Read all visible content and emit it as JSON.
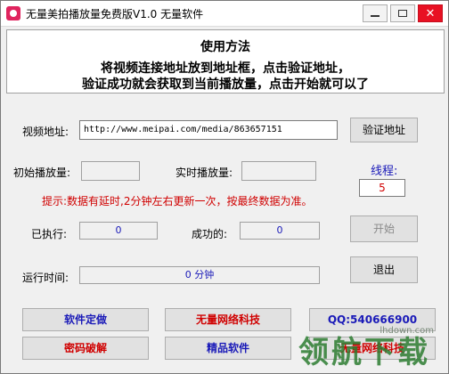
{
  "window": {
    "title": "无量美拍播放量免费版V1.0     无量软件"
  },
  "banner": {
    "title": "使用方法",
    "line1": "将视频连接地址放到地址框，点击验证地址，",
    "line2": "验证成功就会获取到当前播放量，点击开始就可以了"
  },
  "form": {
    "video_url_label": "视频地址:",
    "video_url_value": "http://www.meipai.com/media/863657151",
    "verify_button": "验证地址",
    "initial_plays_label": "初始播放量:",
    "realtime_plays_label": "实时播放量:",
    "thread_label": "线程:",
    "thread_value": "5",
    "hint": "提示:数据有延时,2分钟左右更新一次，按最终数据为准。",
    "executed_label": "已执行:",
    "executed_value": "0",
    "success_label": "成功的:",
    "success_value": "0",
    "start_button": "开始",
    "runtime_label": "运行时间:",
    "runtime_value": "0 分钟",
    "exit_button": "退出"
  },
  "footer": {
    "btn_software_custom": "软件定做",
    "btn_wuliang_tech": "无量网络科技",
    "btn_qq": "QQ:540666900",
    "btn_crack": "密码破解",
    "btn_quality_software": "精品软件",
    "btn_wuliang_tech_2": "无量网络科技"
  },
  "watermark": {
    "text": "领航下载",
    "url": "lhdown.com"
  },
  "colors": {
    "close_red": "#e81123",
    "accent_blue": "#1a1ab8",
    "hint_red": "#d00000"
  }
}
